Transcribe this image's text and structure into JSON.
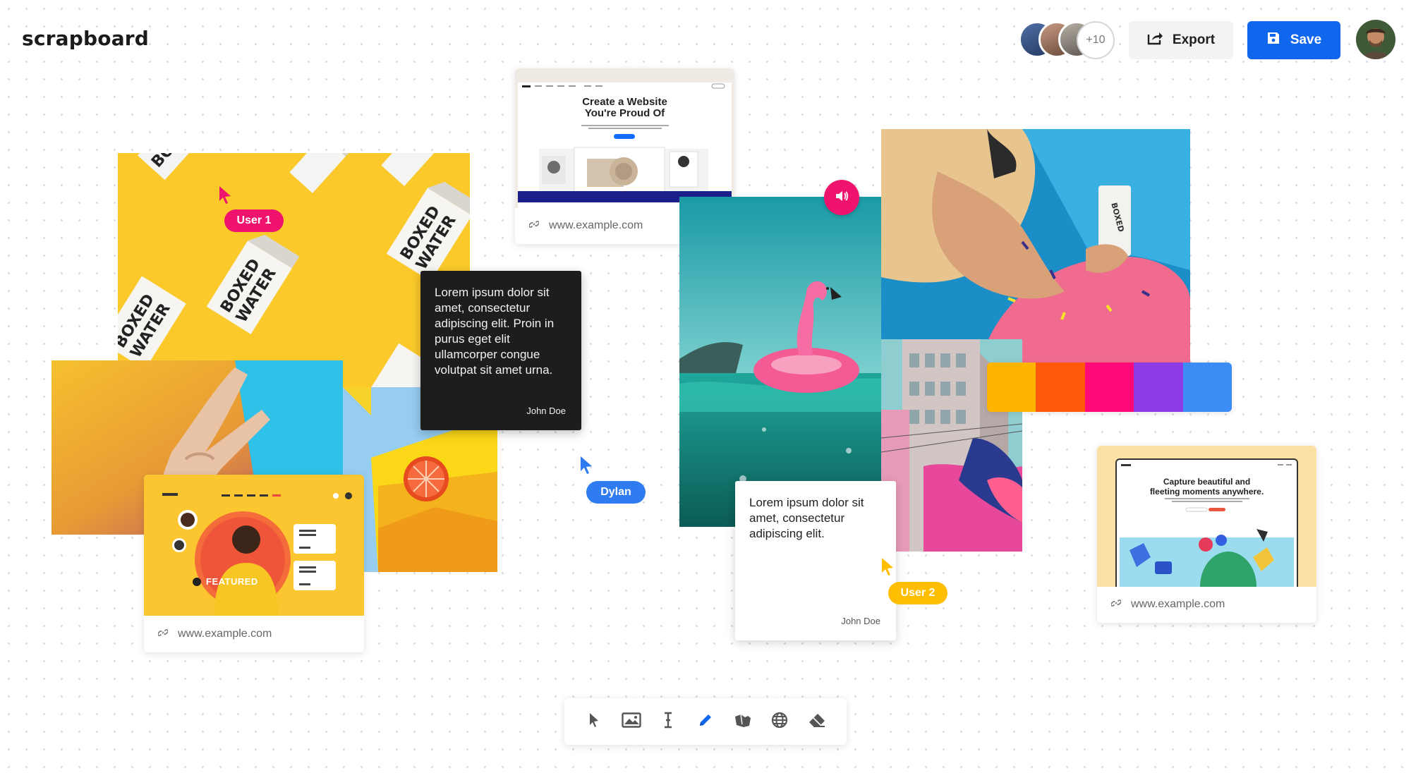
{
  "app": {
    "name": "scrapboard"
  },
  "header": {
    "collaborators_more": "+10",
    "export_label": "Export",
    "save_label": "Save"
  },
  "colors": {
    "accent": "#1166EE",
    "user_pink": "#F0136E",
    "user_blue": "#2F7BF0",
    "user_yellow": "#FFBE00"
  },
  "palette": [
    "#FFB400",
    "#FF5A0A",
    "#FF0A78",
    "#8C3CE6",
    "#3C8CF5"
  ],
  "cards": {
    "wix": {
      "headline_1": "Create a Website",
      "headline_2": "You're Proud Of",
      "url": "www.example.com"
    },
    "northface": {
      "featured": "FEATURED",
      "url": "www.example.com"
    },
    "capture": {
      "headline_1": "Capture beautiful and",
      "headline_2": "fleeting moments anywhere.",
      "url": "www.example.com"
    }
  },
  "notes": {
    "dark": {
      "text": "Lorem ipsum dolor sit amet, consectetur adipiscing elit. Proin in purus eget elit ullamcorper congue volutpat sit amet urna.",
      "author": "John Doe"
    },
    "light": {
      "text": "Lorem ipsum dolor sit amet, consectetur adipiscing elit.",
      "author": "John Doe"
    }
  },
  "cursors": {
    "user1": "User 1",
    "dylan": "Dylan",
    "user2": "User 2"
  },
  "images": {
    "boxed_water_text": "BOXED WATER"
  },
  "toolbar": {
    "tools": [
      "select-tool",
      "image-tool",
      "text-tool",
      "pen-tool",
      "shapes-tool",
      "web-tool",
      "eraser-tool"
    ]
  }
}
